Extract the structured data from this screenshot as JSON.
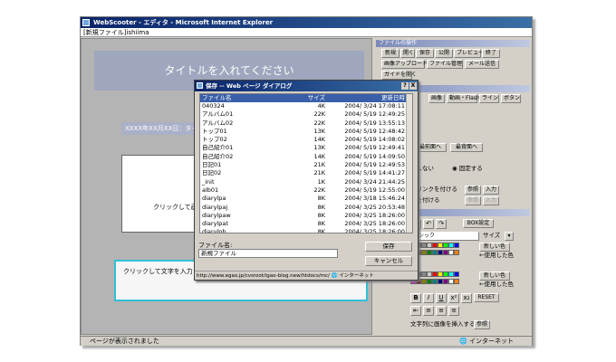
{
  "window": {
    "title": "WebScooter - エディタ - Microsoft Internet Explorer",
    "address": "[新規ファイル]ishiima"
  },
  "editor": {
    "page_title": "タイトルを入れてください",
    "date_text": "XXXX年XX月XX日：タイト",
    "content_hint": "クリックして画",
    "text_box_hint": "クリックして文字を入力"
  },
  "toolpanel": {
    "file_section": "ファイルの操作",
    "buttons_row1": [
      "新規",
      "開く",
      "保存",
      "公開",
      "プレビュー",
      "終了"
    ],
    "buttons_row2": [
      "画像アップロード",
      "ファイル管理",
      "メール送信"
    ],
    "guide_button": "ガイドを開く",
    "insert_section": "パーツの挿入",
    "insert_buttons": [
      "ボタン",
      "画像",
      "動画・Flash",
      "ライン"
    ],
    "order_buttons": [
      "最前面へ",
      "最背面へ"
    ],
    "position_text": "定しない",
    "position_fixed": "固定する",
    "link_text": "にリンクを付ける",
    "link_btn1": "参照",
    "link_btn2": "入力",
    "link2_text": "クを付ける",
    "link2_btn1": "参照",
    "link2_btn2": "入力",
    "text_section": "の文字の編集",
    "box_setting": "BOX設定",
    "font_value": "ゴシック",
    "size_label": "サイズ",
    "new_color": "新しい色",
    "used_color": "←使用した色",
    "new_color2": "新しい色",
    "used_color2": "←使用した色",
    "reset": "RESET",
    "image_insert_text": "文字列に画像を挿入する",
    "image_insert_btn": "参照"
  },
  "status": {
    "text": "ページが表示されました",
    "zone": "インターネット"
  },
  "dialog": {
    "title": "保存 -- Web ページ ダイアログ",
    "help": "?",
    "close": "X",
    "columns": [
      "ファイル名",
      "サイズ",
      "更新日時"
    ],
    "files": [
      [
        "040324",
        "4K",
        "2004/ 3/24 17:08:11"
      ],
      [
        "アルバム01",
        "22K",
        "2004/ 5/19 12:49:25"
      ],
      [
        "アルバム02",
        "22K",
        "2004/ 5/19 13:55:13"
      ],
      [
        "トップ01",
        "13K",
        "2004/ 5/19 12:48:42"
      ],
      [
        "トップ02",
        "14K",
        "2004/ 5/19 14:08:02"
      ],
      [
        "自己紹介01",
        "13K",
        "2004/ 5/19 12:49:41"
      ],
      [
        "自己紹介02",
        "14K",
        "2004/ 5/19 14:09:50"
      ],
      [
        "日記01",
        "21K",
        "2004/ 5/19 12:49:53"
      ],
      [
        "日記02",
        "21K",
        "2004/ 5/19 14:41:27"
      ],
      [
        "_init",
        "1K",
        "2004/ 3/24 21:44:25"
      ],
      [
        "alb01",
        "22K",
        "2004/ 5/19 12:55:00"
      ],
      [
        "diarylpa",
        "8K",
        "2004/ 3/18 15:46:24"
      ],
      [
        "diarylpaj",
        "8K",
        "2004/ 3/25 20:53:48"
      ],
      [
        "diarylpaw",
        "8K",
        "2004/ 3/25 18:26:00"
      ],
      [
        "diarylpat",
        "8K",
        "2004/ 3/25 18:26:00"
      ],
      [
        "diarylpb",
        "8K",
        "2004/ 3/25 18:26:00"
      ]
    ],
    "filename_label": "ファイル名:",
    "filename_value": "新規ファイル",
    "save": "保存",
    "cancel": "キャンセル",
    "status_url": "http://www.egao.jp/cvsroot/igao-blog.new/htdocs/mc/",
    "status_zone": "インターネット"
  },
  "colors": {
    "title_blue": "#0a246a",
    "cyan_border": "#30c0d8",
    "palette": [
      "#000000",
      "#444444",
      "#888888",
      "#cccccc",
      "#ff0000",
      "#ffff00",
      "#00ff00",
      "#00ffff",
      "#0000ff",
      "#ff00ff",
      "#800000",
      "#808000",
      "#008000",
      "#008080",
      "#000080",
      "#800080",
      "#ffffff",
      "#ff8000"
    ]
  }
}
